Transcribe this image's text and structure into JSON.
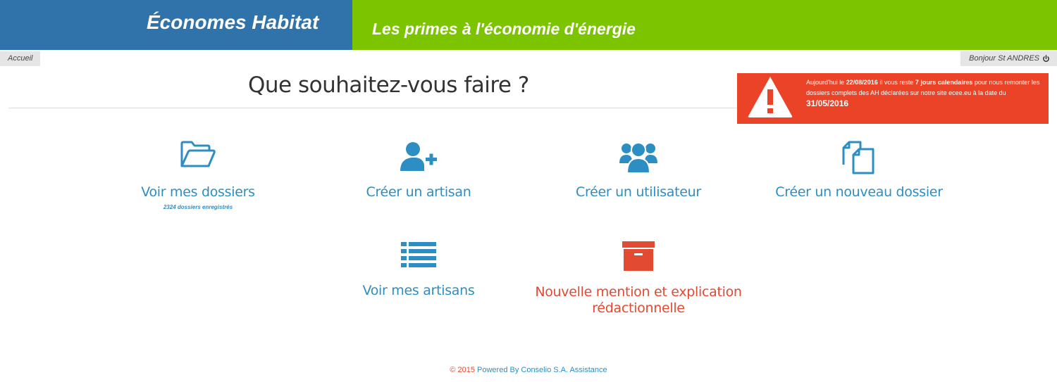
{
  "header": {
    "brand": "Économes Habitat",
    "tagline": "Les primes à l'économie d'énergie",
    "colors": {
      "brand_bg": "#2f73aa",
      "tagline_bg": "#7cc400"
    }
  },
  "nav": {
    "breadcrumb": "Accueil",
    "user_greeting": "Bonjour St ANDRES",
    "user_icon": "power-icon"
  },
  "page": {
    "title": "Que souhaitez-vous faire ?"
  },
  "alert": {
    "icon": "warning-icon",
    "bg_color": "#ea4327",
    "t1": "Aujourd'hui le ",
    "date": "22/08/2016",
    "t2": " il vous reste ",
    "days": "7 jours calendaires",
    "t3": " pour nous remonter les dossiers complets des AH déclarées sur notre site ecee.eu à la date du ",
    "deadline": "31/05/2016"
  },
  "actions": [
    {
      "label": "Voir mes dossiers",
      "sub": "2324 dossiers enregistrés",
      "icon": "folder-open-icon",
      "color": "#2d8ec4"
    },
    {
      "label": "Créer un artisan",
      "icon": "user-plus-icon",
      "color": "#2d8ec4"
    },
    {
      "label": "Créer un utilisateur",
      "icon": "users-icon",
      "color": "#2d8ec4"
    },
    {
      "label": "Créer un nouveau dossier",
      "icon": "copy-files-icon",
      "color": "#2d8ec4"
    },
    {
      "label": "Voir mes artisans",
      "icon": "list-icon",
      "color": "#2d8ec4"
    },
    {
      "label": "Nouvelle mention et explication rédactionnelle",
      "icon": "archive-box-icon",
      "color": "#e24a32"
    }
  ],
  "footer": {
    "copyright": "© 2015",
    "powered": "Powered By Conselio S.A. Assistance"
  }
}
